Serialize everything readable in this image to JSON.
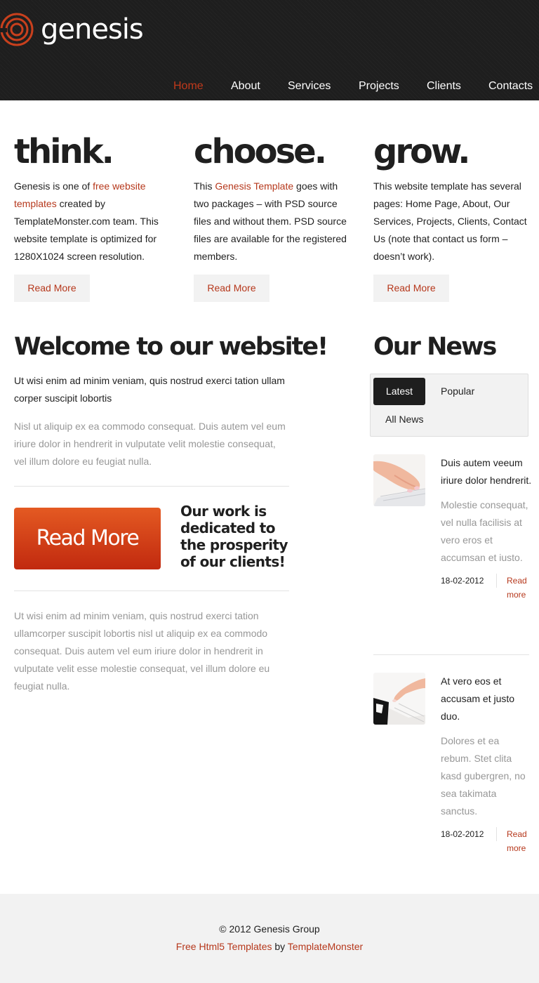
{
  "brand": {
    "name": "genesis",
    "accent": "#b6381c",
    "dark": "#1e1e1e"
  },
  "nav": [
    {
      "label": "Home",
      "active": true
    },
    {
      "label": "About"
    },
    {
      "label": "Services"
    },
    {
      "label": "Projects"
    },
    {
      "label": "Clients"
    },
    {
      "label": "Contacts"
    }
  ],
  "columns": [
    {
      "title": "think.",
      "text_before": "Genesis is one of ",
      "link": "free website templates",
      "text_after": " created by TemplateMonster.com team. This website template is optimized for 1280X1024 screen resolution.",
      "button": "Read More"
    },
    {
      "title": "choose.",
      "text_before": "This ",
      "link": "Genesis Template",
      "text_after": " goes with two packages – with PSD source files and without them. PSD source files are available for the registered members.",
      "button": "Read More"
    },
    {
      "title": "grow.",
      "text_before": "This website template has several pages: Home Page, About, Our Services, Projects, Clients, Contact Us (note that contact us form – doesn’t work).",
      "link": "",
      "text_after": "",
      "button": "Read More"
    }
  ],
  "welcome": {
    "title": "Welcome to our website!",
    "intro": "Ut wisi enim ad minim veniam, quis nostrud exerci tation ullam corper suscipit lobortis",
    "text1": "Nisl ut aliquip ex ea commodo consequat. Duis autem vel eum iriure dolor in hendrerit in vulputate velit molestie consequat, vel illum dolore eu feugiat nulla.",
    "big_button": "Read More",
    "tagline": "Our work is dedicated to the prosperity of our clients!",
    "text2": "Ut wisi enim ad minim veniam, quis nostrud exerci tation ullamcorper suscipit lobortis nisl ut aliquip ex ea commodo consequat. Duis autem vel eum iriure dolor in hendrerit in vulputate velit esse molestie consequat, vel illum dolore eu feugiat nulla."
  },
  "news": {
    "title": "Our News",
    "tabs": [
      "Latest",
      "Popular",
      "All News"
    ],
    "items": [
      {
        "headline": "Duis autem veeum iriure dolor hendrerit.",
        "body": "Molestie consequat, vel nulla facilisis at vero eros et accumsan et iusto.",
        "date": "18-02-2012",
        "more": "Read more",
        "image": "hands-on-keyboard-photo"
      },
      {
        "headline": "At vero eos et accusam et justo duo.",
        "body": "Dolores et ea rebum. Stet clita kasd gubergren, no sea takimata sanctus.",
        "date": "18-02-2012",
        "more": "Read more",
        "image": "hand-on-piano-keys-photo"
      }
    ]
  },
  "footer": {
    "copyright": "© 2012 Genesis Group",
    "link1": "Free Html5 Templates",
    "by": " by ",
    "link2": "TemplateMonster"
  }
}
